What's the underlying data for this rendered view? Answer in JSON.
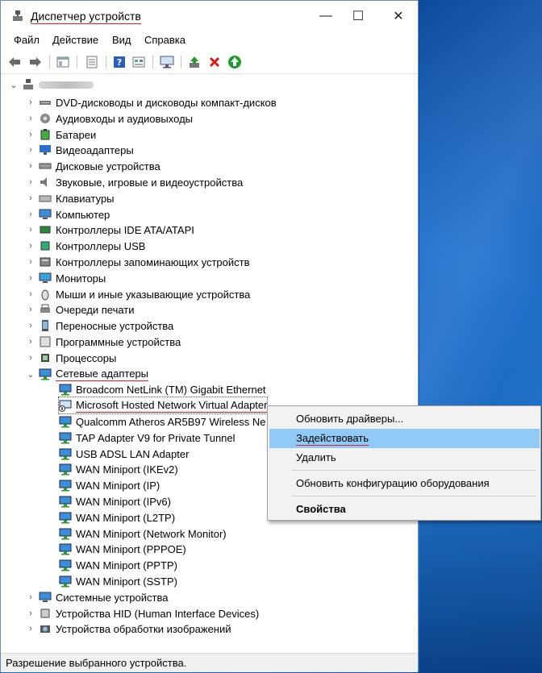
{
  "window": {
    "title": "Диспетчер устройств",
    "minimize": "—",
    "maximize": "☐",
    "close": "✕"
  },
  "menu": [
    "Файл",
    "Действие",
    "Вид",
    "Справка"
  ],
  "tree": {
    "categories_top": [
      "DVD-дисководы и дисководы компакт-дисков",
      "Аудиовходы и аудиовыходы",
      "Батареи",
      "Видеоадаптеры",
      "Дисковые устройства",
      "Звуковые, игровые и видеоустройства",
      "Клавиатуры",
      "Компьютер",
      "Контроллеры IDE ATA/ATAPI",
      "Контроллеры USB",
      "Контроллеры запоминающих устройств",
      "Мониторы",
      "Мыши и иные указывающие устройства",
      "Очереди печати",
      "Переносные устройства",
      "Программные устройства",
      "Процессоры"
    ],
    "network_label": "Сетевые адаптеры",
    "network_children": [
      "Broadcom NetLink (TM) Gigabit Ethernet",
      "Microsoft Hosted Network Virtual Adapter",
      "Qualcomm Atheros AR5B97 Wireless Ne",
      "TAP Adapter V9 for Private Tunnel",
      "USB ADSL LAN Adapter",
      "WAN Miniport (IKEv2)",
      "WAN Miniport (IP)",
      "WAN Miniport (IPv6)",
      "WAN Miniport (L2TP)",
      "WAN Miniport (Network Monitor)",
      "WAN Miniport (PPPOE)",
      "WAN Miniport (PPTP)",
      "WAN Miniport (SSTP)"
    ],
    "categories_bottom": [
      "Системные устройства",
      "Устройства HID (Human Interface Devices)",
      "Устройства обработки изображений"
    ]
  },
  "context_menu": {
    "update": "Обновить драйверы...",
    "enable": "Задействовать",
    "delete": "Удалить",
    "scan": "Обновить конфигурацию оборудования",
    "properties": "Свойства"
  },
  "status": "Разрешение выбранного устройства.",
  "colors": {
    "accent_red": "#e02020",
    "highlight": "#91c9f7",
    "desktop": "#0b4fa3"
  }
}
